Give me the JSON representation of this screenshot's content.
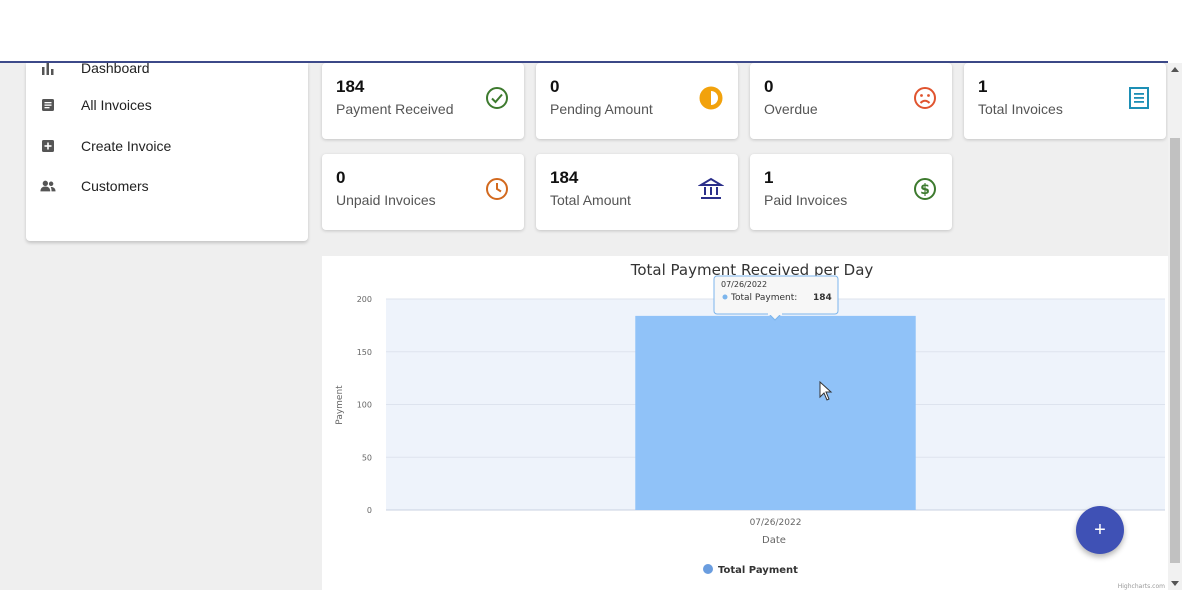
{
  "sidebar": {
    "items": [
      {
        "label": "Dashboard",
        "icon": "bar-chart-icon"
      },
      {
        "label": "All Invoices",
        "icon": "document-icon"
      },
      {
        "label": "Create Invoice",
        "icon": "add-box-icon"
      },
      {
        "label": "Customers",
        "icon": "people-icon"
      }
    ]
  },
  "cards": [
    {
      "value": "184",
      "label": "Payment Received",
      "icon": "check-circle-icon",
      "color": "#3d7a2e"
    },
    {
      "value": "0",
      "label": "Pending Amount",
      "icon": "pie-icon",
      "color": "#f2a20c"
    },
    {
      "value": "0",
      "label": "Overdue",
      "icon": "frown-icon",
      "color": "#e0542f"
    },
    {
      "value": "1",
      "label": "Total Invoices",
      "icon": "invoice-list-icon",
      "color": "#1d8fb5"
    },
    {
      "value": "0",
      "label": "Unpaid Invoices",
      "icon": "clock-icon",
      "color": "#d2691e"
    },
    {
      "value": "184",
      "label": "Total Amount",
      "icon": "bank-icon",
      "color": "#2b2f8a"
    },
    {
      "value": "1",
      "label": "Paid Invoices",
      "icon": "dollar-circle-icon",
      "color": "#3d7a2e"
    }
  ],
  "chart_data": {
    "type": "bar",
    "title": "Total Payment Received per Day",
    "xlabel": "Date",
    "ylabel": "Payment",
    "categories": [
      "07/26/2022"
    ],
    "series": [
      {
        "name": "Total Payment",
        "values": [
          184
        ],
        "color": "#90c2f8"
      }
    ],
    "ylim": [
      0,
      200
    ],
    "yticks": [
      0,
      50,
      100,
      150,
      200
    ],
    "legend": "bottom",
    "tooltip": {
      "title": "07/26/2022",
      "series_label": "Total Payment:",
      "value": "184"
    },
    "credits": "Highcharts.com"
  },
  "fab": {
    "label": "+"
  }
}
